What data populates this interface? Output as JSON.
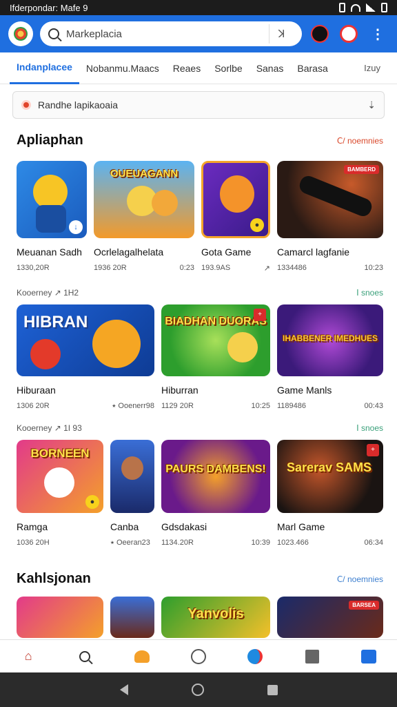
{
  "status_bar": {
    "left_text": "Ifderpondar: Mafe 9"
  },
  "app_bar": {
    "search_placeholder": "Markeplacia",
    "mic_glyph": "ꓘ"
  },
  "tabs": [
    {
      "label": "Indanplacee",
      "active": true
    },
    {
      "label": "Nobanmu.Maacs",
      "active": false
    },
    {
      "label": "Reaes",
      "active": false
    },
    {
      "label": "Sorlbe",
      "active": false
    },
    {
      "label": "Sanas",
      "active": false
    },
    {
      "label": "Barasa",
      "active": false
    },
    {
      "label": "Izuy",
      "active": false
    }
  ],
  "notice": {
    "text": "Randhe lapikaoaia",
    "arrow": "⇣"
  },
  "section1": {
    "title": "Apliaphan",
    "see_all": "Ⅽ/ noemnies",
    "see_all_color": "#d9482b",
    "cards": [
      {
        "name": "Meuanan Sadh",
        "meta_left": "1330,20R",
        "meta_right": ""
      },
      {
        "name": "Ocrlelagalhelata",
        "meta_left": "1936 20R",
        "meta_right": "0:23",
        "thumb_text": "OUEUAGANN"
      },
      {
        "name": "Gota Game",
        "meta_left": "193.9AS",
        "meta_right": "↗"
      },
      {
        "name": "Camarcl lagfanie",
        "meta_left": "1334486",
        "meta_right": "10:23",
        "badge": "BAMBERD"
      }
    ]
  },
  "row2": {
    "sub_title": "Kooerney ↗ 1H2",
    "sub_link": "Ⅰ snoes",
    "cards": [
      {
        "name": "Hiburaan",
        "meta_left": "1306 20R",
        "meta_right": "⭑ Ooenerr98",
        "thumb_text": "HIBRAN"
      },
      {
        "name": "Hiburran",
        "meta_left": "1129 20R",
        "meta_right": "10:25",
        "thumb_text": "BIADHAN DUORAS"
      },
      {
        "name": "Game Manls",
        "meta_left": "1189486",
        "meta_right": "00:43",
        "thumb_text": "IHABBENER IMEDHUES"
      }
    ]
  },
  "row3": {
    "sub_title": "Kooerney ↗ 1I 93",
    "sub_link": "Ⅰ snoes",
    "cards": [
      {
        "name": "Ramga",
        "meta_left": "1036 20H",
        "meta_right": "",
        "thumb_text": "BORNEEN"
      },
      {
        "name": "Canba",
        "meta_left": "⭑ Oeeran23",
        "meta_right": ""
      },
      {
        "name": "Gdsdakasi",
        "meta_left": "1134.20R",
        "meta_right": "10:39",
        "thumb_text": "PAURS DAMBENS!"
      },
      {
        "name": "Marl Game",
        "meta_left": "1023.466",
        "meta_right": "06:34",
        "thumb_text": "Sarerav SAMS"
      }
    ]
  },
  "section2": {
    "title": "Kahlsjonan",
    "see_all": "Ⅽ/ noemnies",
    "see_all_color": "#3d7fcf",
    "cards": [
      {
        "badge": ""
      },
      {
        "badge": ""
      },
      {
        "thumb_text": "Yanvolis"
      },
      {
        "badge": "BARSEA"
      }
    ]
  },
  "icons": {
    "logo": "flower-logo-icon",
    "search": "search-icon",
    "mic": "mic-icon",
    "app1": "game-app-icon",
    "notifications": "notification-icon",
    "more": "more-vert-icon"
  },
  "colors": {
    "primary": "#1f6fe0",
    "accent_red": "#d92b2b",
    "link_green": "#3aa07a"
  }
}
